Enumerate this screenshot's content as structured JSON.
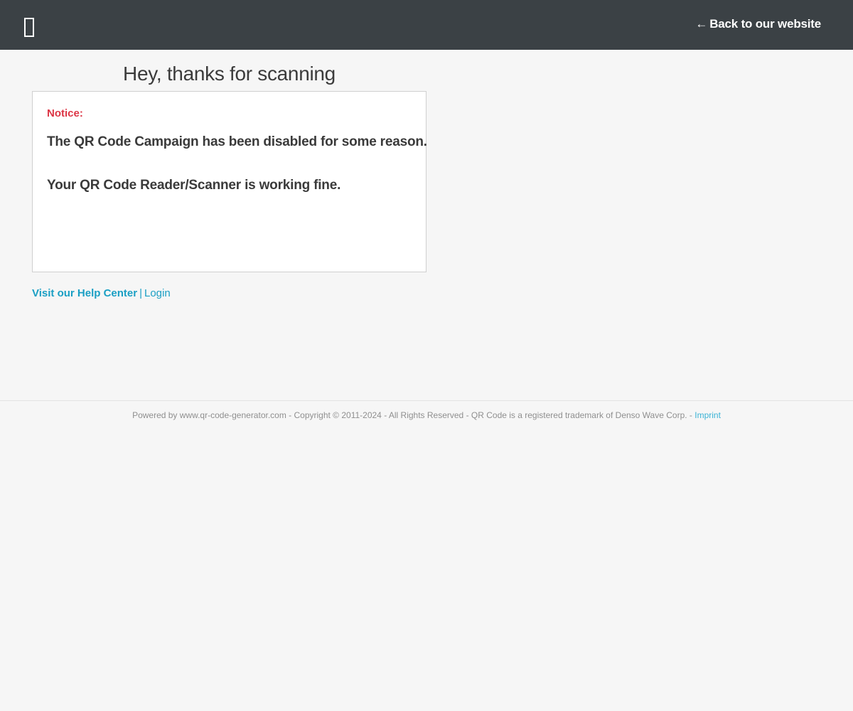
{
  "header": {
    "logo_icon": "blank-rectangle-icon",
    "back_label": "Back to our website",
    "back_arrow": "←"
  },
  "main": {
    "title": "Hey, thanks for scanning",
    "notice": {
      "label": "Notice:",
      "line1": "The QR Code Campaign has been disabled for some reason.",
      "line2": "Your QR Code Reader/Scanner is working fine."
    },
    "links": {
      "help_center": "Visit our Help Center",
      "separator": "|",
      "login": "Login"
    }
  },
  "footer": {
    "text": "Powered by www.qr-code-generator.com - Copyright © 2011-2024 - All Rights Reserved - QR Code is a registered trademark of Denso Wave Corp. - ",
    "imprint": "Imprint"
  },
  "colors": {
    "header_bg": "#3b4145",
    "page_bg": "#f6f6f6",
    "notice_red": "#dc3545",
    "link_blue": "#1a9fc4"
  }
}
